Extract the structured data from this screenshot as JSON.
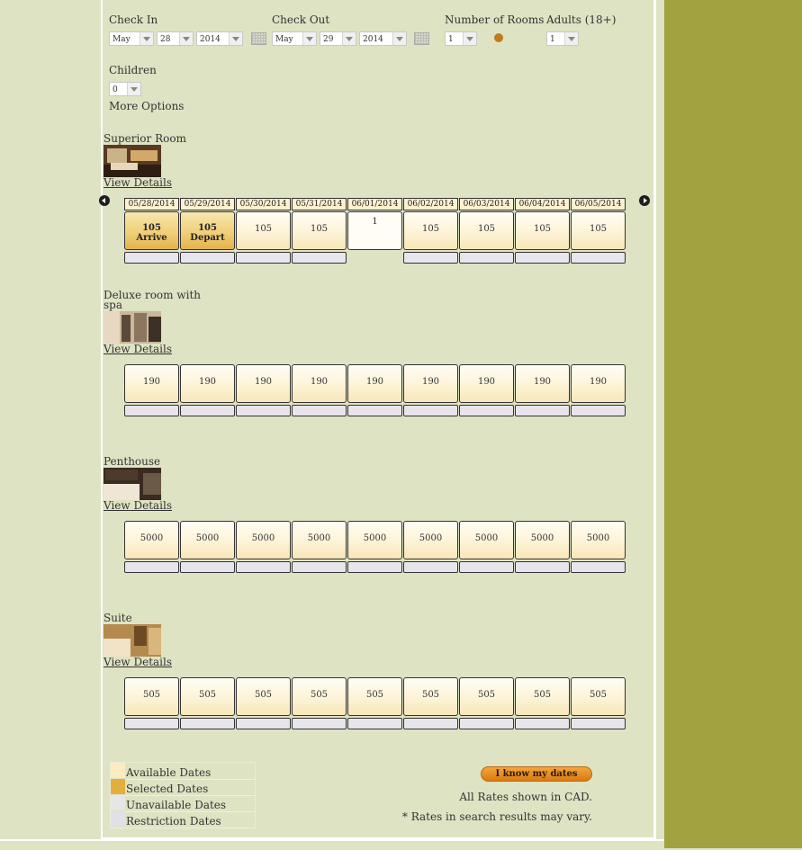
{
  "search": {
    "check_in_label": "Check In",
    "check_in_month": "May",
    "check_in_day": "28",
    "check_in_year": "2014",
    "check_out_label": "Check Out",
    "check_out_month": "May",
    "check_out_day": "29",
    "check_out_year": "2014",
    "rooms_label": "Number of Rooms",
    "rooms_value": "1",
    "adults_label": "Adults (18+)",
    "adults_value": "1",
    "children_label": "Children",
    "children_value": "0",
    "more_options": "More Options"
  },
  "dates": [
    "05/28/2014",
    "05/29/2014",
    "05/30/2014",
    "05/31/2014",
    "06/01/2014",
    "06/02/2014",
    "06/03/2014",
    "06/04/2014",
    "06/05/2014"
  ],
  "rooms": [
    {
      "name": "Superior Room",
      "details_link": "View Details",
      "rates": [
        {
          "value": "105",
          "note": "Arrive",
          "state": "selected"
        },
        {
          "value": "105",
          "note": "Depart",
          "state": "selected"
        },
        {
          "value": "105",
          "note": "",
          "state": "available"
        },
        {
          "value": "105",
          "note": "",
          "state": "available"
        },
        {
          "value": "1",
          "note": "",
          "state": "unavailable"
        },
        {
          "value": "105",
          "note": "",
          "state": "available"
        },
        {
          "value": "105",
          "note": "",
          "state": "available"
        },
        {
          "value": "105",
          "note": "",
          "state": "available"
        },
        {
          "value": "105",
          "note": "",
          "state": "available"
        }
      ]
    },
    {
      "name": "Deluxe room with spa",
      "details_link": "View Details",
      "rates": [
        {
          "value": "190",
          "note": "",
          "state": "available"
        },
        {
          "value": "190",
          "note": "",
          "state": "available"
        },
        {
          "value": "190",
          "note": "",
          "state": "available"
        },
        {
          "value": "190",
          "note": "",
          "state": "available"
        },
        {
          "value": "190",
          "note": "",
          "state": "available"
        },
        {
          "value": "190",
          "note": "",
          "state": "available"
        },
        {
          "value": "190",
          "note": "",
          "state": "available"
        },
        {
          "value": "190",
          "note": "",
          "state": "available"
        },
        {
          "value": "190",
          "note": "",
          "state": "available"
        }
      ]
    },
    {
      "name": "Penthouse",
      "details_link": "View Details",
      "rates": [
        {
          "value": "5000",
          "note": "",
          "state": "available"
        },
        {
          "value": "5000",
          "note": "",
          "state": "available"
        },
        {
          "value": "5000",
          "note": "",
          "state": "available"
        },
        {
          "value": "5000",
          "note": "",
          "state": "available"
        },
        {
          "value": "5000",
          "note": "",
          "state": "available"
        },
        {
          "value": "5000",
          "note": "",
          "state": "available"
        },
        {
          "value": "5000",
          "note": "",
          "state": "available"
        },
        {
          "value": "5000",
          "note": "",
          "state": "available"
        },
        {
          "value": "5000",
          "note": "",
          "state": "available"
        }
      ]
    },
    {
      "name": "Suite",
      "details_link": "View Details",
      "rates": [
        {
          "value": "505",
          "note": "",
          "state": "available"
        },
        {
          "value": "505",
          "note": "",
          "state": "available"
        },
        {
          "value": "505",
          "note": "",
          "state": "available"
        },
        {
          "value": "505",
          "note": "",
          "state": "available"
        },
        {
          "value": "505",
          "note": "",
          "state": "available"
        },
        {
          "value": "505",
          "note": "",
          "state": "available"
        },
        {
          "value": "505",
          "note": "",
          "state": "available"
        },
        {
          "value": "505",
          "note": "",
          "state": "available"
        },
        {
          "value": "505",
          "note": "",
          "state": "available"
        }
      ]
    }
  ],
  "legend": [
    {
      "label": "Available Dates",
      "color": "#fcecc0"
    },
    {
      "label": "Selected Dates",
      "color": "#e4ae3c"
    },
    {
      "label": "Unavailable Dates",
      "color": "#e6e6e6"
    },
    {
      "label": "Restriction Dates",
      "color": "#e2dfe8"
    }
  ],
  "footer": {
    "dates_button": "I know my dates",
    "currency_note": "All Rates shown in CAD.",
    "vary_note": "* Rates in search results may vary."
  },
  "colors": {
    "page_bg": "#dee3c3",
    "right_bg": "#a3a240",
    "button": "#e38d1f"
  }
}
